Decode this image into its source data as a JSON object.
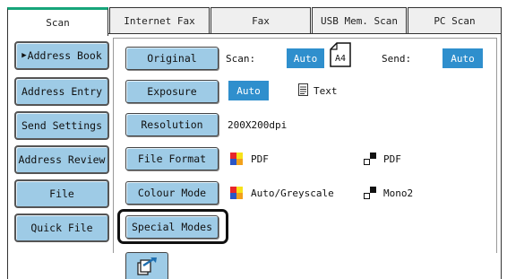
{
  "tabs": [
    {
      "label": "Scan",
      "active": true
    },
    {
      "label": "Internet Fax",
      "active": false
    },
    {
      "label": "Fax",
      "active": false
    },
    {
      "label": "USB Mem. Scan",
      "active": false
    },
    {
      "label": "PC Scan",
      "active": false
    }
  ],
  "nav": {
    "items": [
      {
        "label": "Address Book"
      },
      {
        "label": "Address Entry"
      },
      {
        "label": "Send Settings"
      },
      {
        "label": "Address Review"
      },
      {
        "label": "File"
      },
      {
        "label": "Quick File"
      }
    ]
  },
  "settings": {
    "original": {
      "button": "Original",
      "scan_label": "Scan:",
      "scan_value": "Auto",
      "paper_size": "A4",
      "send_label": "Send:",
      "send_value": "Auto"
    },
    "exposure": {
      "button": "Exposure",
      "value": "Auto",
      "mode": "Text"
    },
    "resolution": {
      "button": "Resolution",
      "value": "200X200dpi"
    },
    "file_format": {
      "button": "File Format",
      "color_value": "PDF",
      "mono_value": "PDF"
    },
    "colour_mode": {
      "button": "Colour Mode",
      "color_value": "Auto/Greyscale",
      "mono_value": "Mono2"
    },
    "special_modes": {
      "button": "Special Modes"
    }
  },
  "colors": {
    "button_blue": "#9ecbe6",
    "value_blue": "#2f8fcd",
    "active_tab_accent": "#16a57a"
  },
  "icons": {
    "paper": "paper-size-icon",
    "text": "text-document-icon",
    "color": "color-squares-icon",
    "mono": "mono-squares-icon",
    "bottom": "scan-send-icon"
  }
}
